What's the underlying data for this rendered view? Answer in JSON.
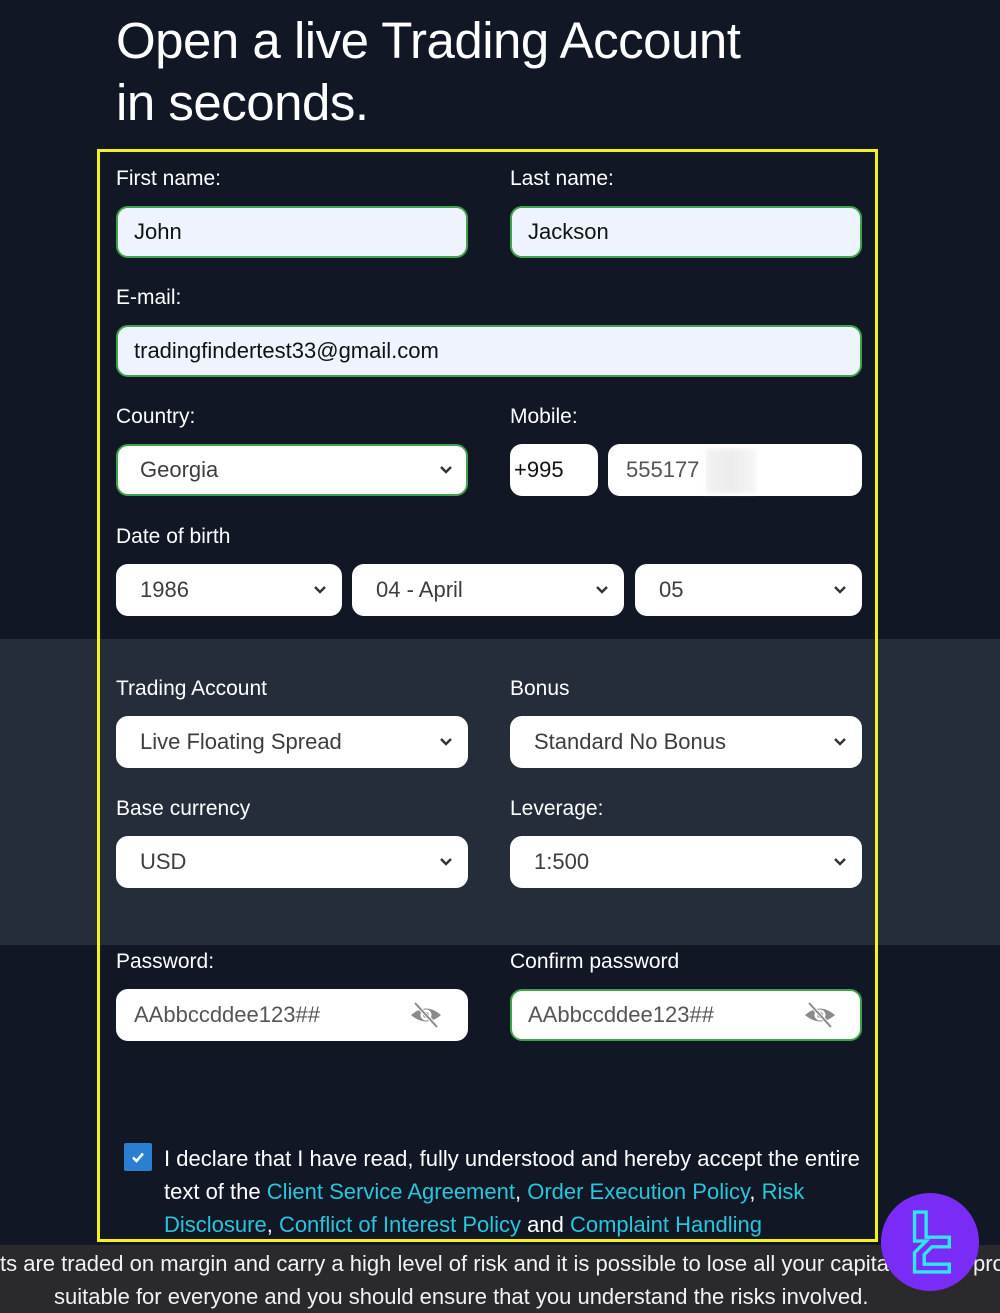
{
  "page": {
    "title_line1": "Open a live Trading Account",
    "title_line2": "in seconds."
  },
  "form": {
    "first_name": {
      "label": "First name:",
      "value": "John"
    },
    "last_name": {
      "label": "Last name:",
      "value": "Jackson"
    },
    "email": {
      "label": "E-mail:",
      "value": "tradingfindertest33@gmail.com"
    },
    "country": {
      "label": "Country:",
      "value": "Georgia"
    },
    "mobile": {
      "label": "Mobile:",
      "prefix": "+995",
      "value": "555177"
    },
    "dob": {
      "label": "Date of birth",
      "year": "1986",
      "month": "04 - April",
      "day": "05"
    },
    "trading_account": {
      "label": "Trading Account",
      "value": "Live Floating Spread"
    },
    "bonus": {
      "label": "Bonus",
      "value": "Standard No Bonus"
    },
    "base_currency": {
      "label": "Base currency",
      "value": "USD"
    },
    "leverage": {
      "label": "Leverage:",
      "value": "1:500"
    },
    "password": {
      "label": "Password:",
      "value": "AAbbccddee123##"
    },
    "confirm_password": {
      "label": "Confirm password",
      "value": "AAbbccddee123##"
    },
    "declaration": {
      "checked": true,
      "text_1": "I declare that I have read, fully understood and hereby accept the entire text of the ",
      "link_1": "Client Service Agreement",
      "sep_1": ", ",
      "link_2": "Order Execution Policy",
      "sep_2": ", ",
      "link_3": "Risk Disclosure",
      "sep_3": ", ",
      "link_4": "Conflict of Interest Policy",
      "sep_4": " and ",
      "link_5": "Complaint Handling"
    }
  },
  "footer": {
    "line1": "ts are traded on margin and carry a high level of risk and it is possible to lose all your capital. These products are not",
    "line2": "suitable for everyone and you should ensure that you understand the risks involved."
  },
  "colors": {
    "background": "#121726",
    "band": "#252d3a",
    "valid_border": "#3fa34a",
    "link": "#27c6dc",
    "checkbox": "#2b7fd0",
    "highlight": "#f4f21b",
    "logo_bg": "#7a2cf6",
    "logo_fg": "#2ee6f0"
  }
}
